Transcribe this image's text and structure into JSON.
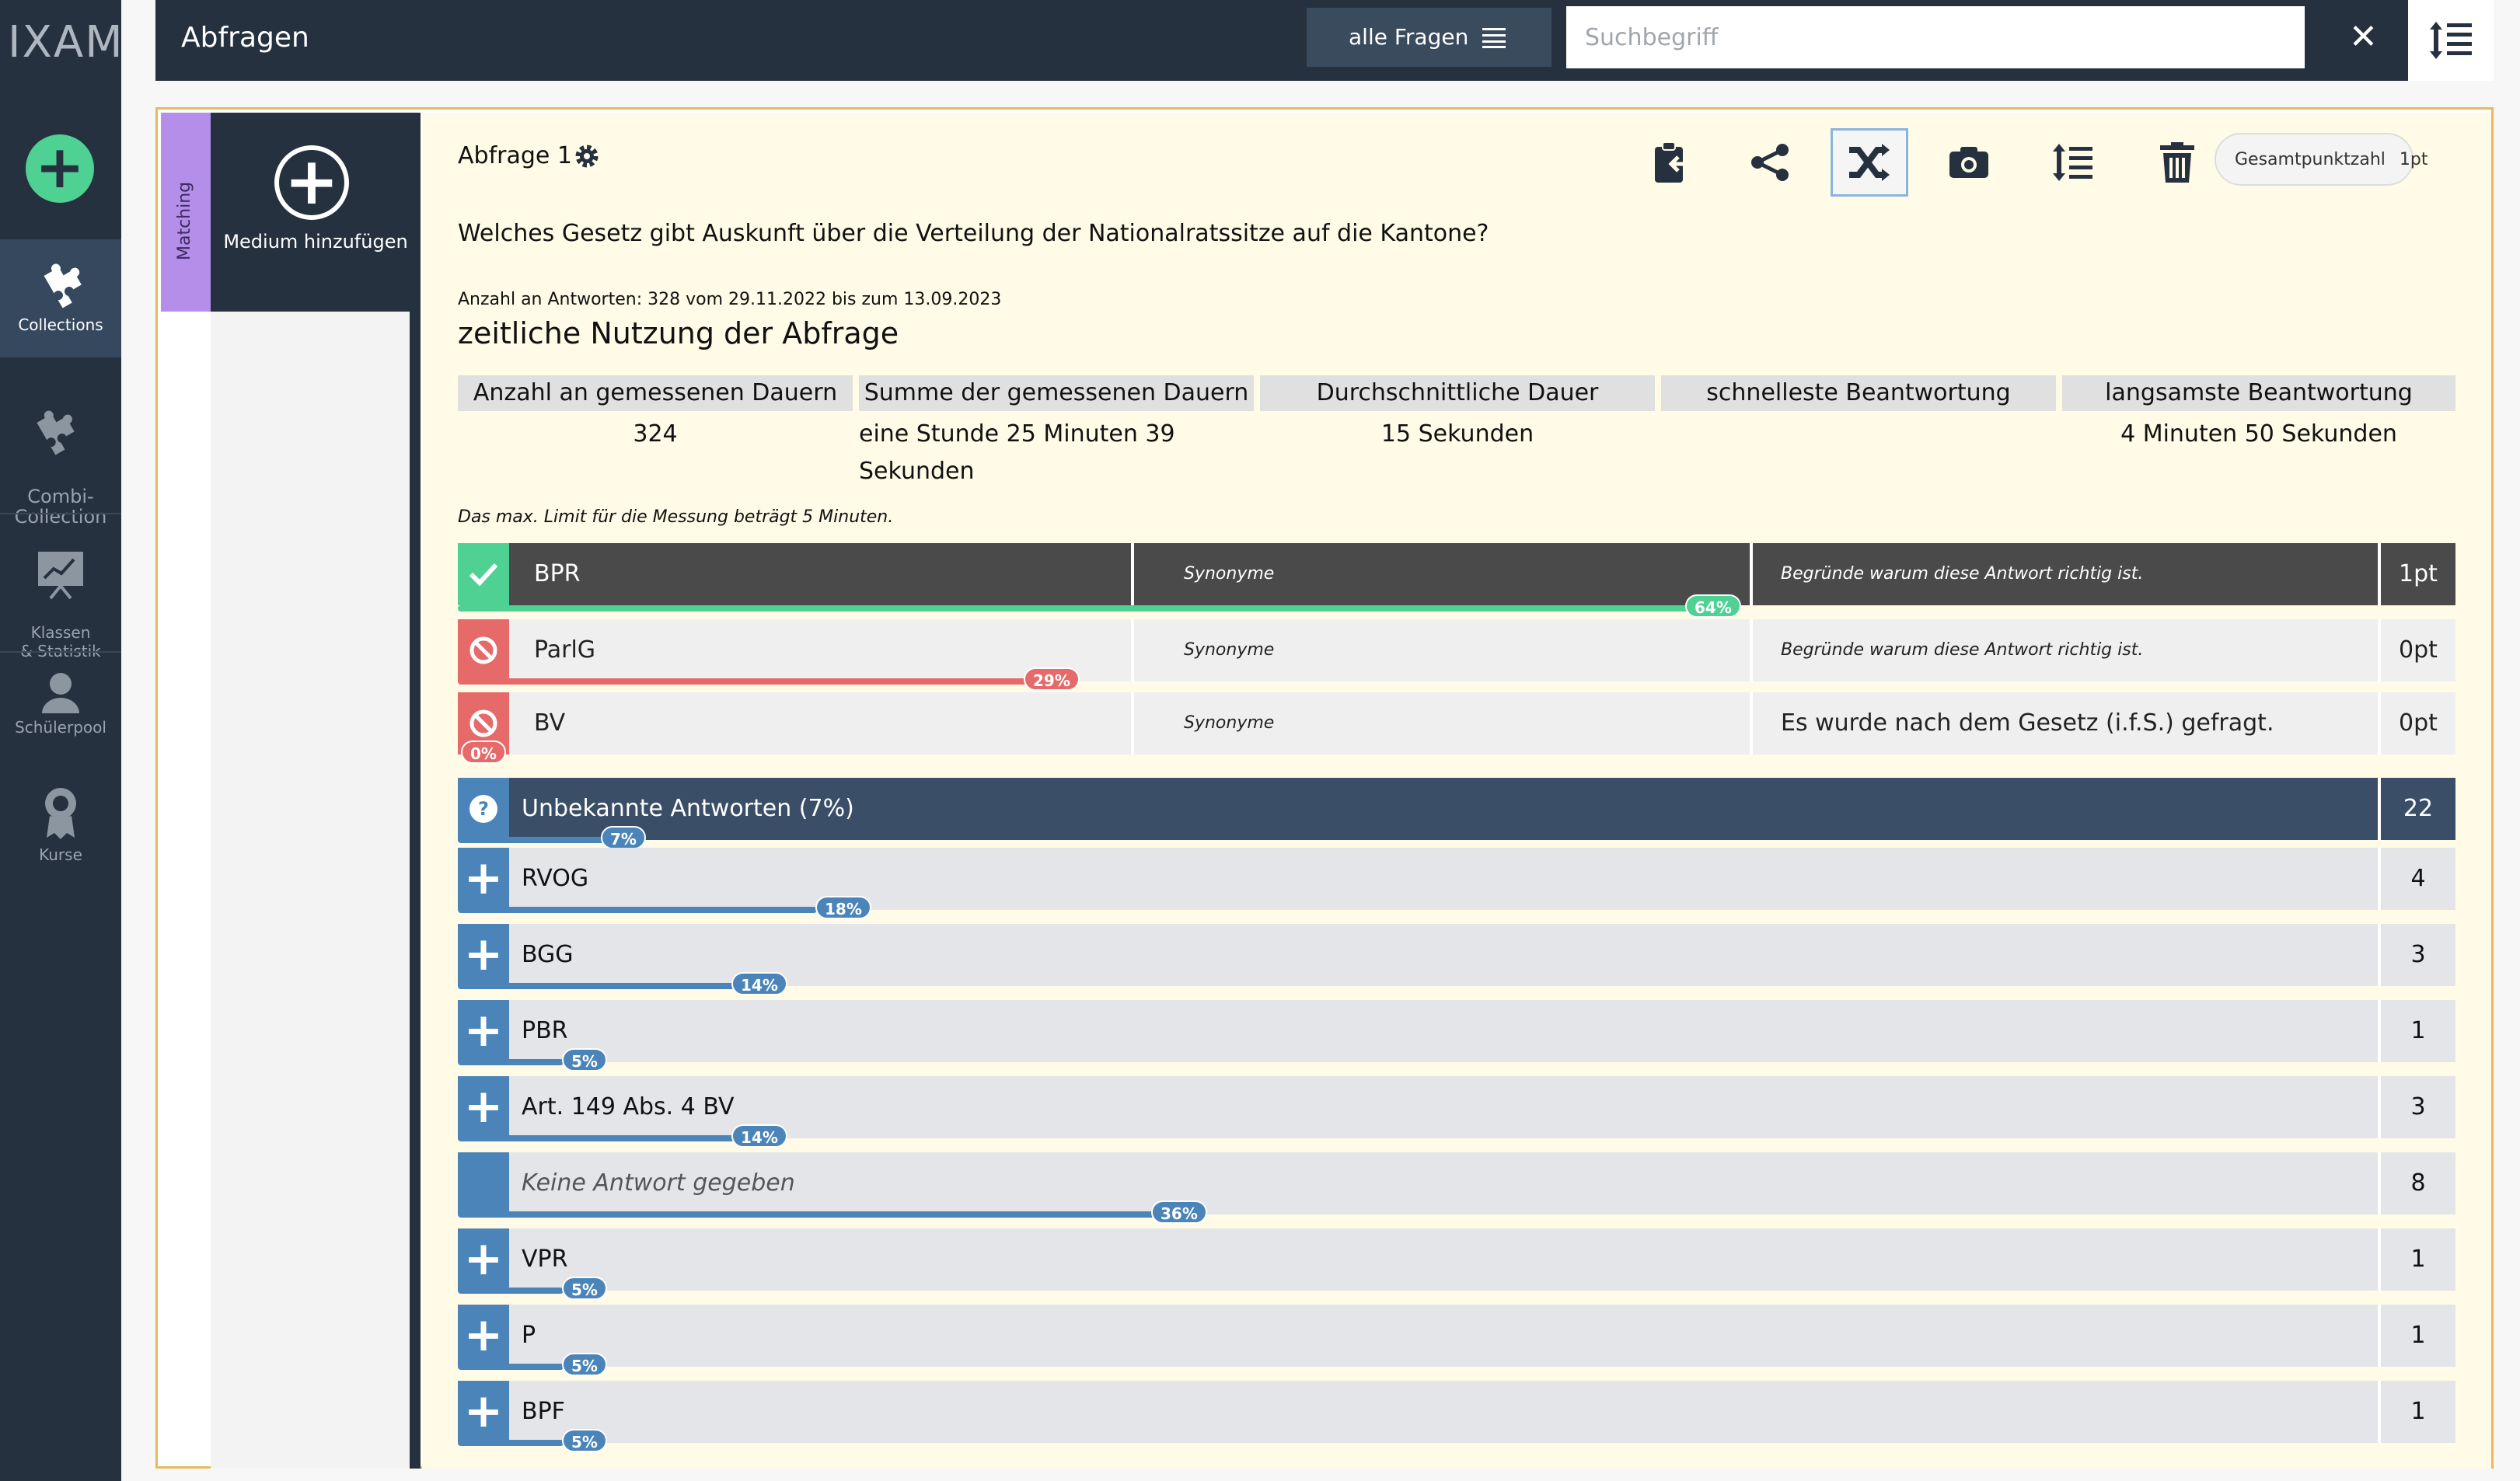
{
  "sidebar": {
    "logo": "IXAM",
    "items": [
      {
        "label": "Collections"
      },
      {
        "label": "Combi-\nCollection"
      },
      {
        "label": "Klassen\n& Statistik"
      },
      {
        "label": "Schülerpool"
      },
      {
        "label": "Kurse"
      }
    ]
  },
  "header": {
    "title": "Abfragen",
    "filter_label": "alle Fragen",
    "search_placeholder": "Suchbegriff"
  },
  "panel": {
    "type_label": "Matching",
    "media_label": "Medium hinzufügen"
  },
  "question": {
    "title": "Abfrage 1",
    "points_label": "Gesamtpunktzahl",
    "points_value": "1pt",
    "text": "Welches Gesetz gibt Auskunft über die Verteilung der Nationalratssitze auf die Kantone?",
    "meta": "Anzahl an Antworten: 328 vom 29.11.2022 bis zum 13.09.2023",
    "usage_title": "zeitliche Nutzung der Abfrage"
  },
  "stats": {
    "headers": [
      "Anzahl an gemessenen Dauern",
      "Summe der gemessenen Dauern",
      "Durchschnittliche Dauer",
      "schnelleste Beantwortung",
      "langsamste Beantwortung"
    ],
    "values": [
      "324",
      "eine Stunde 25 Minuten 39 Sekunden",
      "15 Sekunden",
      "",
      "4 Minuten 50 Sekunden"
    ],
    "note": "Das max. Limit für die Messung beträgt 5 Minuten."
  },
  "answers": [
    {
      "name": "BPR",
      "synonyms": "Synonyme",
      "reason": "Begründe warum diese Antwort richtig ist.",
      "points": "1pt",
      "percent": 64,
      "percent_label": "64%"
    },
    {
      "name": "ParlG",
      "synonyms": "Synonyme",
      "reason": "Begründe warum diese Antwort richtig ist.",
      "points": "0pt",
      "percent": 29,
      "percent_label": "29%"
    },
    {
      "name": "BV",
      "synonyms": "Synonyme",
      "reason": "Es wurde nach dem Gesetz (i.f.S.) gefragt.",
      "points": "0pt",
      "percent": 0,
      "percent_label": "0%"
    }
  ],
  "unknown": {
    "title": "Unbekannte Antworten  (7%)",
    "count": "22",
    "percent": 7,
    "percent_label": "7%",
    "rows": [
      {
        "name": "RVOG",
        "count": "4",
        "percent": 18,
        "percent_label": "18%"
      },
      {
        "name": "BGG",
        "count": "3",
        "percent": 14,
        "percent_label": "14%"
      },
      {
        "name": "PBR",
        "count": "1",
        "percent": 5,
        "percent_label": "5%"
      },
      {
        "name": "Art. 149 Abs. 4 BV",
        "count": "3",
        "percent": 14,
        "percent_label": "14%"
      },
      {
        "name": "Keine Antwort gegeben",
        "count": "8",
        "percent": 36,
        "percent_label": "36%"
      },
      {
        "name": "VPR",
        "count": "1",
        "percent": 5,
        "percent_label": "5%"
      },
      {
        "name": "P",
        "count": "1",
        "percent": 5,
        "percent_label": "5%"
      },
      {
        "name": "BPF",
        "count": "1",
        "percent": 5,
        "percent_label": "5%"
      }
    ]
  },
  "colors": {
    "sidebar": "#26313f",
    "accent_green": "#4fd194",
    "wrong_red": "#e76a6a",
    "unknown_blue": "#4a84b8",
    "panel_border": "#e8b960",
    "type_purple": "#b48ee8"
  }
}
